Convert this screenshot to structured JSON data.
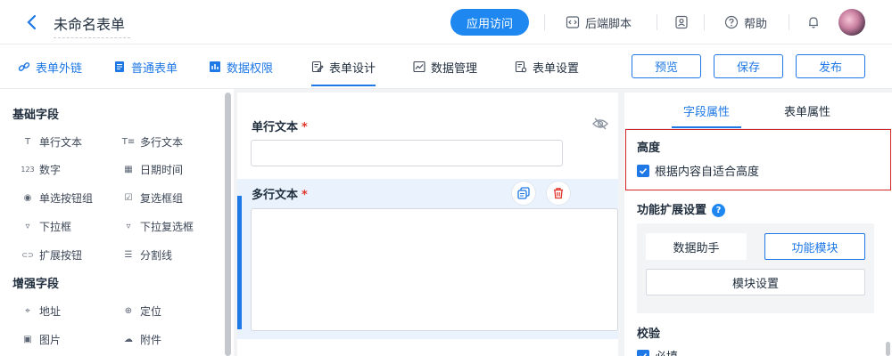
{
  "header": {
    "title": "未命名表单",
    "visit_button": "应用访问",
    "backend_script": "后端脚本",
    "help": "帮助"
  },
  "tabs": [
    {
      "label": "表单外链"
    },
    {
      "label": "普通表单"
    },
    {
      "label": "数据权限"
    },
    {
      "label": "表单设计"
    },
    {
      "label": "数据管理"
    },
    {
      "label": "表单设置"
    }
  ],
  "actions": {
    "preview": "预览",
    "save": "保存",
    "publish": "发布"
  },
  "palette": {
    "basic_title": "基础字段",
    "basic": [
      {
        "label": "单行文本",
        "icon": "T"
      },
      {
        "label": "多行文本",
        "icon": "T≡"
      },
      {
        "label": "数字",
        "icon": "123"
      },
      {
        "label": "日期时间",
        "icon": "▦"
      },
      {
        "label": "单选按钮组",
        "icon": "◉"
      },
      {
        "label": "复选框组",
        "icon": "☑"
      },
      {
        "label": "下拉框",
        "icon": "▿"
      },
      {
        "label": "下拉复选框",
        "icon": "▿"
      },
      {
        "label": "扩展按钮",
        "icon": "⊂⊃"
      },
      {
        "label": "分割线",
        "icon": "☰"
      }
    ],
    "advanced_title": "增强字段",
    "advanced": [
      {
        "label": "地址",
        "icon": "⌖"
      },
      {
        "label": "定位",
        "icon": "⊕"
      },
      {
        "label": "图片",
        "icon": "▣"
      },
      {
        "label": "附件",
        "icon": "☁"
      }
    ]
  },
  "canvas": {
    "field1_label": "单行文本",
    "field2_label": "多行文本",
    "required_mark": "*"
  },
  "props": {
    "tab_field": "字段属性",
    "tab_form": "表单属性",
    "height_title": "高度",
    "auto_height": "根据内容自适合高度",
    "ext_title": "功能扩展设置",
    "data_helper": "数据助手",
    "func_module": "功能模块",
    "module_settings": "模块设置",
    "validate_title": "校验",
    "required": "必填"
  },
  "colors": {
    "accent": "#1e78e6",
    "danger": "#e0352b",
    "highlight": "#d4262a"
  }
}
